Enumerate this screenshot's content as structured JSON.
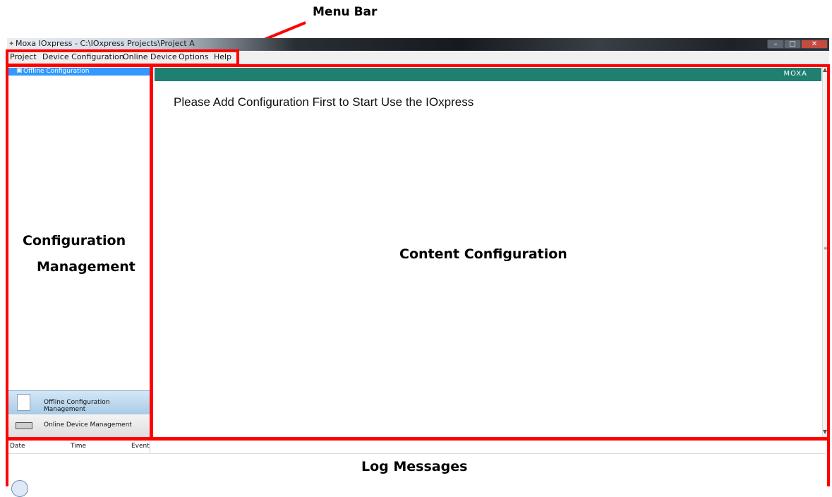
{
  "annotations": {
    "menu_bar": "Menu Bar",
    "config_mgmt_line1": "Configuration",
    "config_mgmt_line2": "Management",
    "content_config": "Content Configuration",
    "log_messages": "Log Messages"
  },
  "window": {
    "title": "Moxa IOxpress - C:\\IOxpress Projects\\Project A",
    "buttons": [
      "–",
      "□",
      "✕"
    ]
  },
  "menu": [
    "Project",
    "Device Configuration",
    "Online Device",
    "Options",
    "Help"
  ],
  "left_pane": {
    "tree_item": "Offline Configuration",
    "offline_btn": "Offline Configuration Management",
    "online_btn": "Online Device Management"
  },
  "content": {
    "brand": "MOXA",
    "message": "Please Add Configuration First to Start Use the IOxpress"
  },
  "log": {
    "columns": [
      "Date",
      "Time",
      "Event"
    ]
  },
  "colors": {
    "annotation_red": "#ff0000",
    "header_teal": "#1f7f71",
    "selection_blue": "#3399ff"
  }
}
